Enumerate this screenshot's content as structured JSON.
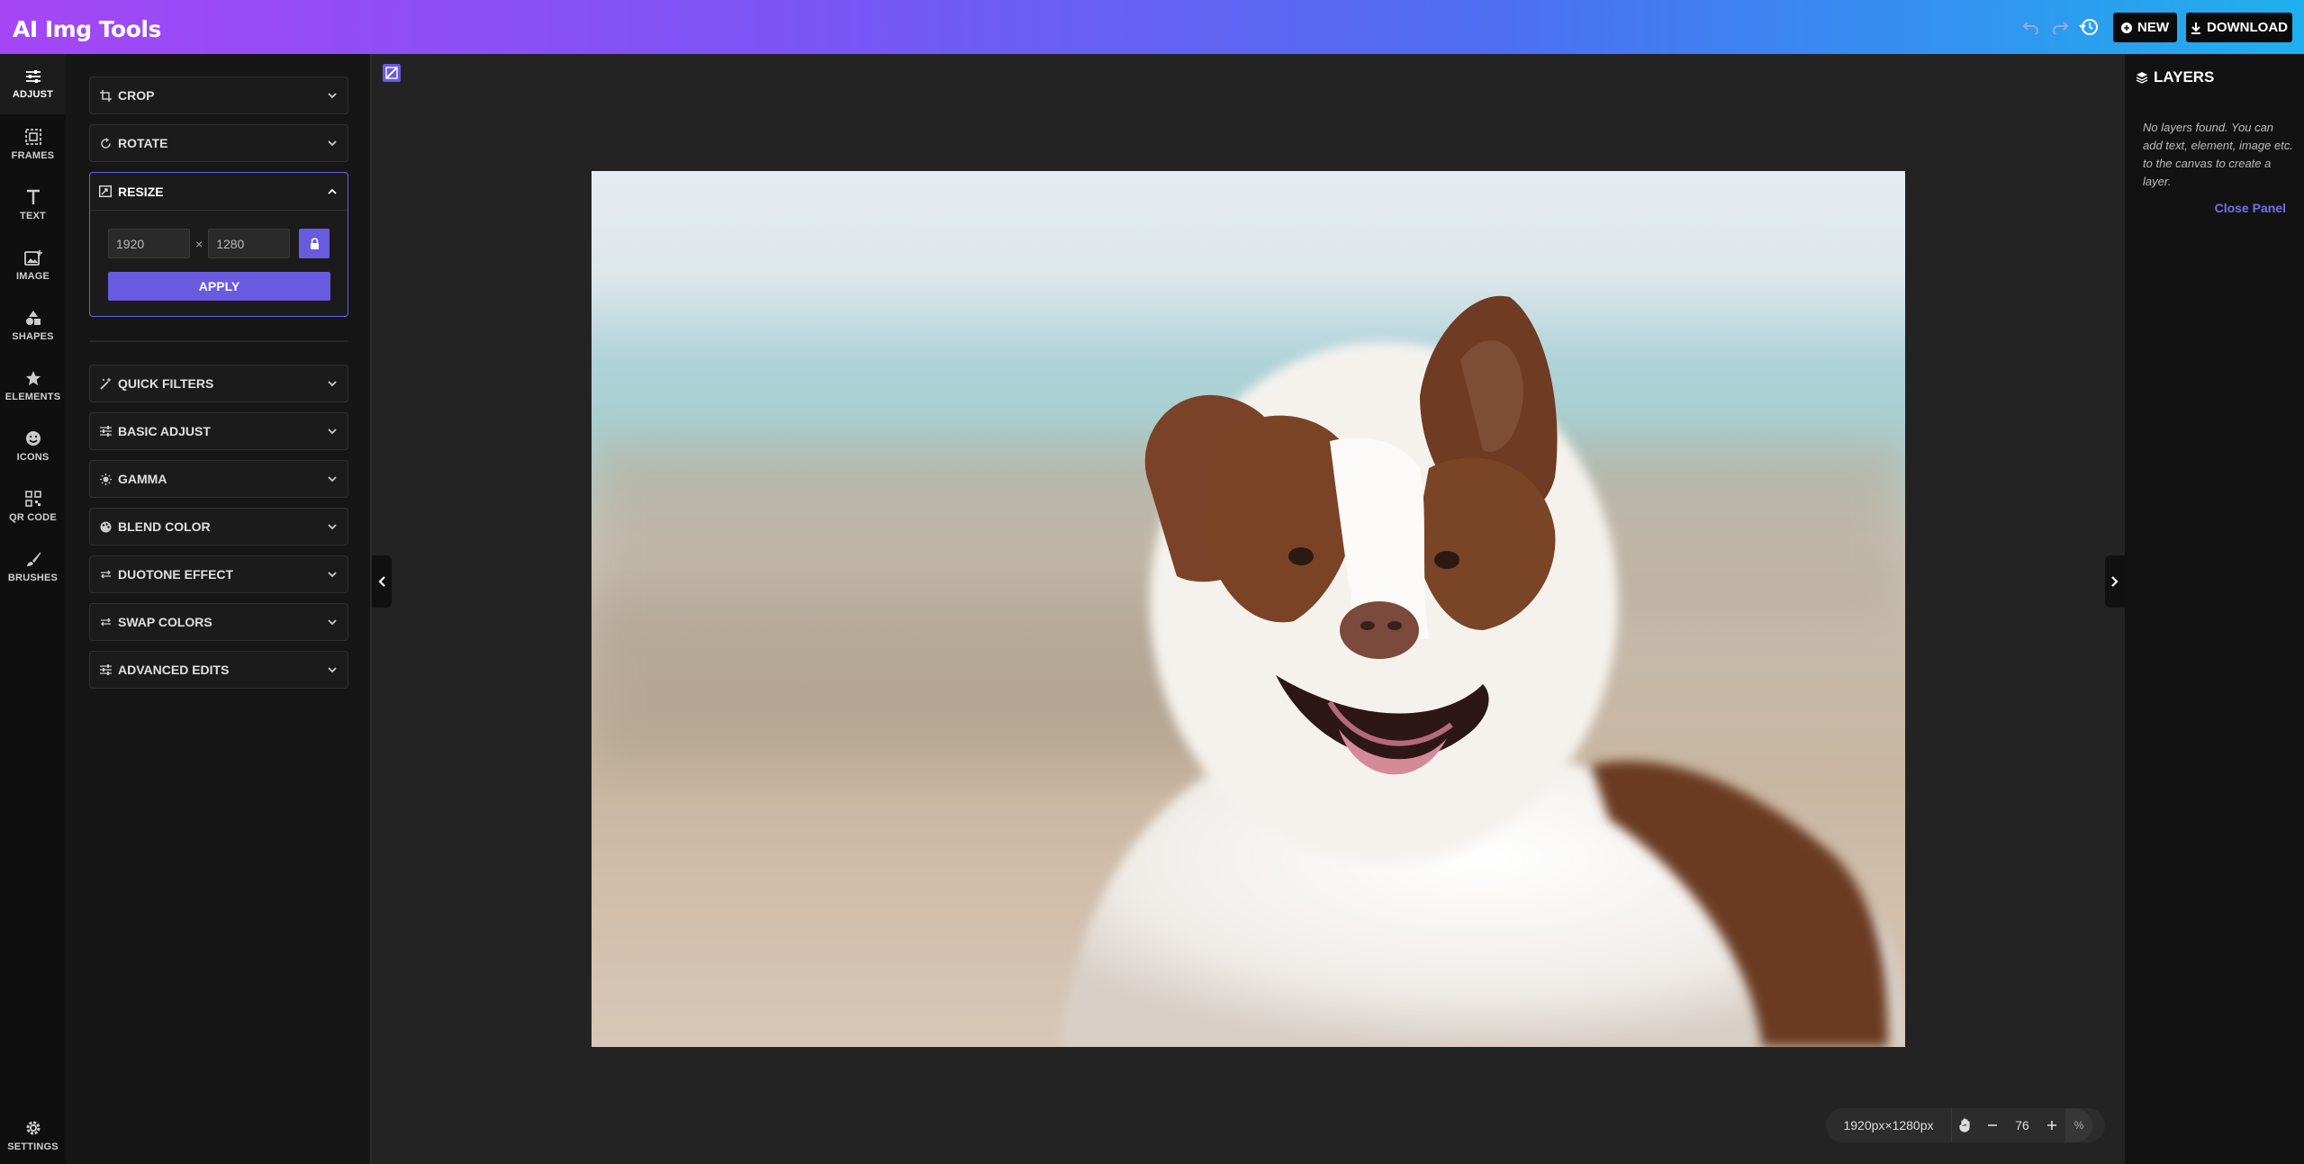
{
  "app": {
    "title": "AI Img Tools"
  },
  "header": {
    "new_label": "NEW",
    "download_label": "DOWNLOAD"
  },
  "sidebar": {
    "items": [
      {
        "label": "ADJUST",
        "icon": "sliders-icon"
      },
      {
        "label": "FRAMES",
        "icon": "frame-icon"
      },
      {
        "label": "TEXT",
        "icon": "text-icon"
      },
      {
        "label": "IMAGE",
        "icon": "image-add-icon"
      },
      {
        "label": "SHAPES",
        "icon": "shapes-icon"
      },
      {
        "label": "ELEMENTS",
        "icon": "star-icon"
      },
      {
        "label": "ICONS",
        "icon": "smiley-icon"
      },
      {
        "label": "QR CODE",
        "icon": "qr-code-icon"
      },
      {
        "label": "BRUSHES",
        "icon": "brush-icon"
      }
    ],
    "settings_label": "SETTINGS"
  },
  "tools": {
    "crop": "CROP",
    "rotate": "ROTATE",
    "resize": {
      "title": "RESIZE",
      "width": "1920",
      "height": "1280",
      "separator": "×",
      "apply_label": "APPLY"
    },
    "quick_filters": "QUICK FILTERS",
    "basic_adjust": "BASIC ADJUST",
    "gamma": "GAMMA",
    "blend_color": "BLEND COLOR",
    "duotone_effect": "DUOTONE EFFECT",
    "swap_colors": "SWAP COLORS",
    "advanced_edits": "ADVANCED EDITS"
  },
  "zoom": {
    "dimensions": "1920px×1280px",
    "value": "76",
    "unit": "%"
  },
  "layers": {
    "title": "LAYERS",
    "empty_message": "No layers found. You can add text, element, image etc. to the canvas to create a layer.",
    "close_label": "Close Panel"
  },
  "colors": {
    "accent": "#6a5ae0",
    "header_gradient_start": "#a446f6",
    "header_gradient_end": "#1fb0ee"
  }
}
